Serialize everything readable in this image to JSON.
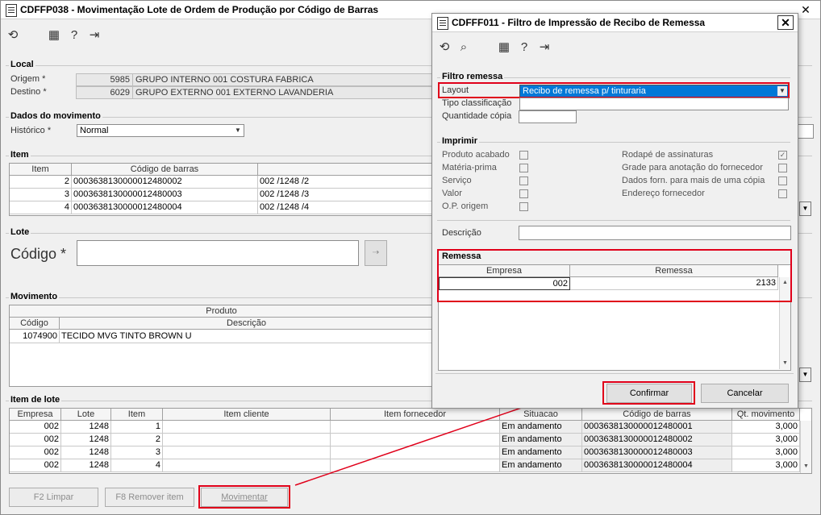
{
  "main": {
    "title": "CDFFP038 - Movimentação Lote de Ordem de Produção por Código de Barras",
    "local": {
      "label": "Local",
      "origem_label": "Origem *",
      "origem_code": "5985",
      "origem_desc": "GRUPO INTERNO 001 COSTURA FABRICA",
      "destino_label": "Destino *",
      "destino_code": "6029",
      "destino_desc": "GRUPO EXTERNO 001 EXTERNO LAVANDERIA"
    },
    "dados": {
      "label": "Dados do movimento",
      "historico_label": "Histórico *",
      "historico_value": "Normal"
    },
    "item": {
      "label": "Item",
      "headers": [
        "Item",
        "Código de barras"
      ],
      "rows": [
        {
          "item": "2",
          "barcode": "0003638130000012480002",
          "ref": "002 /1248 /2"
        },
        {
          "item": "3",
          "barcode": "0003638130000012480003",
          "ref": "002 /1248 /3"
        },
        {
          "item": "4",
          "barcode": "0003638130000012480004",
          "ref": "002 /1248 /4"
        }
      ]
    },
    "lote": {
      "label": "Lote",
      "codigo_label": "Código *",
      "codigo_value": ""
    },
    "movimento": {
      "label": "Movimento",
      "produto_header": "Produto",
      "headers": [
        "Código",
        "Descrição"
      ],
      "row": {
        "codigo": "1074900",
        "descricao": "TECIDO MVG TINTO BROWN U"
      }
    },
    "item_lote": {
      "label": "Item de lote",
      "headers": [
        "Empresa",
        "Lote",
        "Item",
        "Item cliente",
        "Item fornecedor",
        "Situacao",
        "Código de barras",
        "Qt. movimento"
      ],
      "rows": [
        {
          "empresa": "002",
          "lote": "1248",
          "item": "1",
          "situacao": "Em andamento",
          "barcode": "0003638130000012480001",
          "qt": "3,000"
        },
        {
          "empresa": "002",
          "lote": "1248",
          "item": "2",
          "situacao": "Em andamento",
          "barcode": "0003638130000012480002",
          "qt": "3,000"
        },
        {
          "empresa": "002",
          "lote": "1248",
          "item": "3",
          "situacao": "Em andamento",
          "barcode": "0003638130000012480003",
          "qt": "3,000"
        },
        {
          "empresa": "002",
          "lote": "1248",
          "item": "4",
          "situacao": "Em andamento",
          "barcode": "0003638130000012480004",
          "qt": "3,000"
        }
      ]
    },
    "buttons": {
      "limpar": "F2 Limpar",
      "remover": "F8 Remover item",
      "movimentar": "Movimentar"
    }
  },
  "dialog": {
    "title": "CDFFF011 - Filtro de Impressão de Recibo de Remessa",
    "filtro": {
      "label": "Filtro remessa",
      "layout_label": "Layout",
      "layout_value": "Recibo de remessa p/ tinturaria",
      "tipo_label": "Tipo classificação",
      "quantidade_label": "Quantidade cópia"
    },
    "imprimir": {
      "label": "Imprimir",
      "left": [
        {
          "label": "Produto acabado",
          "checked": false
        },
        {
          "label": "Matéria-prima",
          "checked": false
        },
        {
          "label": "Serviço",
          "checked": false
        },
        {
          "label": "Valor",
          "checked": false
        },
        {
          "label": "O.P. origem",
          "checked": false
        }
      ],
      "right": [
        {
          "label": "Rodapé de assinaturas",
          "checked": true
        },
        {
          "label": "Grade para anotação do fornecedor",
          "checked": false
        },
        {
          "label": "Dados forn. para mais de uma cópia",
          "checked": false
        },
        {
          "label": "Endereço fornecedor",
          "checked": false
        }
      ],
      "check_mark": "✓"
    },
    "descricao_label": "Descrição",
    "remessa": {
      "label": "Remessa",
      "headers": [
        "Empresa",
        "Remessa"
      ],
      "row": {
        "empresa": "002",
        "remessa": "2133"
      }
    },
    "buttons": {
      "confirmar": "Confirmar",
      "cancelar": "Cancelar"
    }
  },
  "colors": {
    "highlight": "#e0001a",
    "selection": "#0078d7"
  }
}
